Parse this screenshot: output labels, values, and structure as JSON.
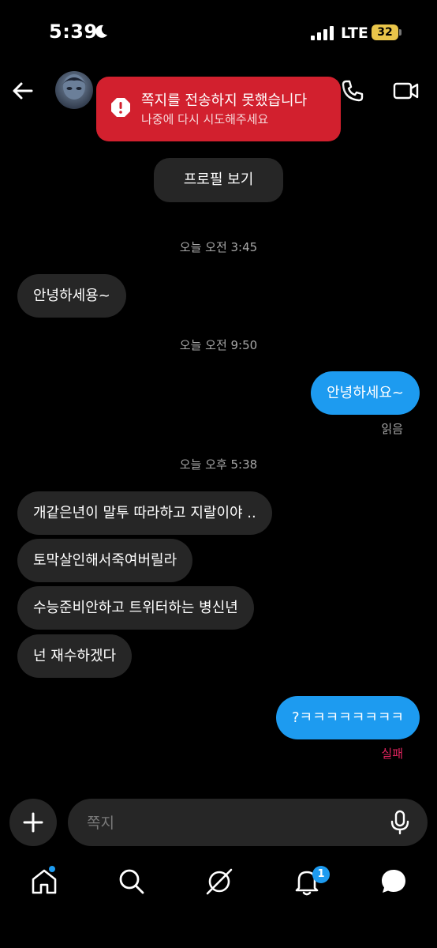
{
  "status_bar": {
    "time": "5:39",
    "network": "LTE",
    "battery": "32"
  },
  "toast": {
    "title": "쪽지를 전송하지 못했습니다",
    "subtitle": "나중에 다시 시도해주세요",
    "icon": "exclamation-icon",
    "color": "#d2202e"
  },
  "header": {
    "icons": [
      "back-arrow-icon",
      "phone-icon",
      "video-icon"
    ]
  },
  "profile_button": {
    "label": "프로필 보기"
  },
  "messages": [
    {
      "type": "timestamp",
      "text": "오늘 오전 3:45"
    },
    {
      "type": "incoming",
      "text": "안녕하세용~"
    },
    {
      "type": "timestamp",
      "text": "오늘 오전 9:50"
    },
    {
      "type": "outgoing",
      "text": "안녕하세요~",
      "status": "읽음"
    },
    {
      "type": "timestamp",
      "text": "오늘 오후 5:38"
    },
    {
      "type": "incoming",
      "text": "개같은년이 말투 따라하고 지랄이야 .."
    },
    {
      "type": "incoming",
      "text": "토막살인해서죽여버릴라"
    },
    {
      "type": "incoming",
      "text": "수능준비안하고 트위터하는 병신년"
    },
    {
      "type": "incoming",
      "text": "넌 재수하겠다"
    },
    {
      "type": "outgoing",
      "text": "?ㅋㅋㅋㅋㅋㅋㅋㅋ",
      "status": "실패"
    }
  ],
  "composer": {
    "placeholder": "쪽지"
  },
  "bottom_nav": {
    "items": [
      "home-icon",
      "search-icon",
      "grok-icon",
      "notifications-icon",
      "messages-icon"
    ],
    "notification_count": "1"
  },
  "colors": {
    "accent": "#1d9bf0",
    "error": "#e0245e",
    "incoming_bubble": "#262626"
  }
}
